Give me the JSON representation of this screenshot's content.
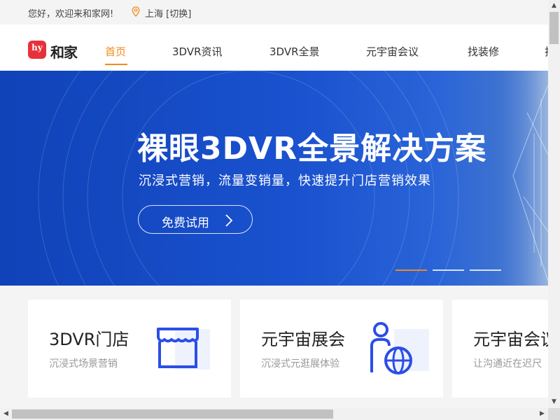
{
  "topbar": {
    "greeting": "您好，欢迎来和家网!",
    "city": "上海 [切换]"
  },
  "logo": {
    "mark": "hy",
    "text": "和家"
  },
  "nav": {
    "items": [
      {
        "label": "首页",
        "active": true
      },
      {
        "label": "3DVR资讯"
      },
      {
        "label": "3DVR全景"
      },
      {
        "label": "元宇宙会议"
      },
      {
        "label": "找装修"
      },
      {
        "label": "找"
      }
    ]
  },
  "banner": {
    "title": "裸眼3DVR全景解决方案",
    "subtitle": "沉浸式营销，流量变销量，快速提升门店营销效果",
    "cta_label": "免费试用",
    "slides_total": 3,
    "active_slide": 1
  },
  "cards": [
    {
      "title": "3DVR门店",
      "subtitle": "沉浸式场景营销",
      "icon": "storefront-icon"
    },
    {
      "title": "元宇宙展会",
      "subtitle": "沉浸式元逛展体验",
      "icon": "person-globe-icon"
    },
    {
      "title": "元宇宙会议",
      "subtitle": "让沟通近在迟尺",
      "icon": "meeting-icon"
    }
  ],
  "colors": {
    "accent": "#f08a1c",
    "banner": "#1a52cf",
    "icon_blue": "#2a4ee6",
    "brand_red": "#e7313a"
  }
}
